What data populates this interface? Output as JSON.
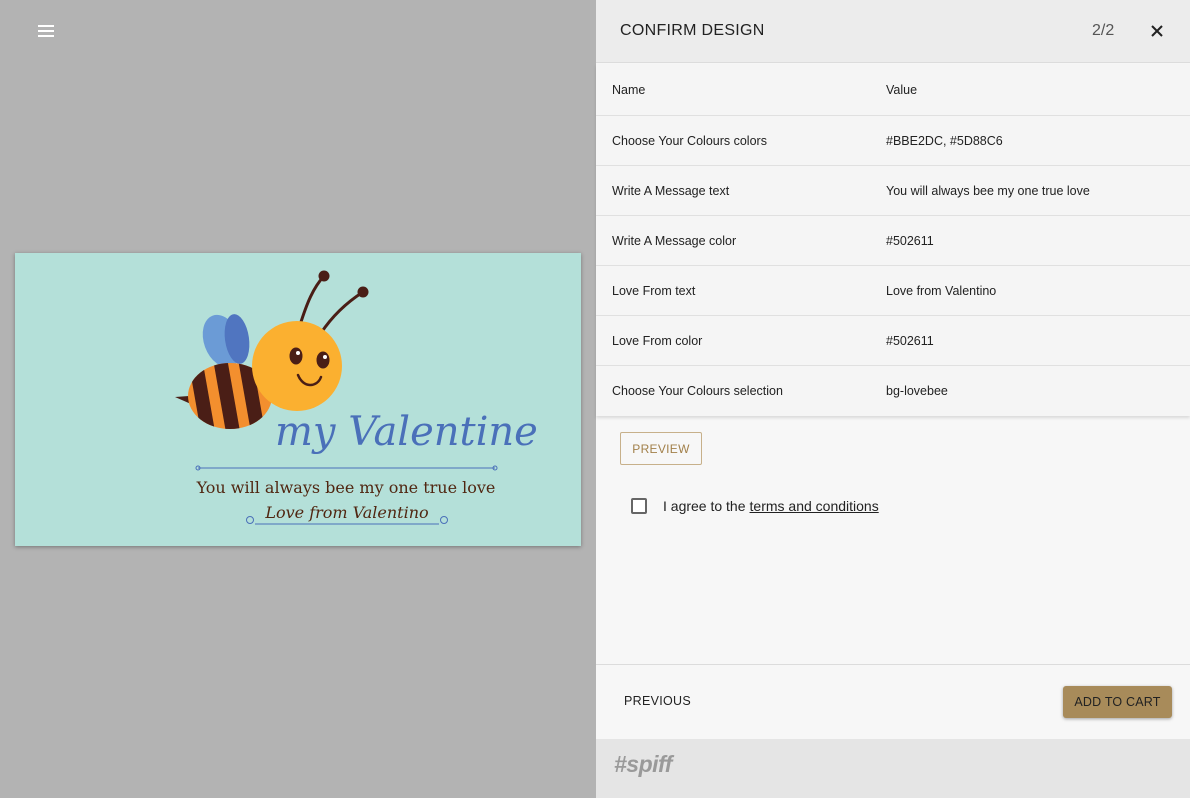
{
  "left": {
    "card": {
      "heading": "my Valentine",
      "message": "You will always bee my one true love",
      "love_from": "Love from Valentino",
      "colors": {
        "background": "#B4E0D9",
        "heading": "#4A70B9",
        "text": "#502611",
        "bee_body": "#FBB030",
        "bee_stripe": "#F38F2E",
        "bee_dark": "#4A1E16",
        "wing_light": "#6B9BD6",
        "wing_dark": "#5075C0"
      }
    }
  },
  "panel": {
    "title": "CONFIRM DESIGN",
    "step": "2/2",
    "table": {
      "header": {
        "name": "Name",
        "value": "Value"
      },
      "rows": [
        {
          "name": "Choose Your Colours colors",
          "value": "#BBE2DC, #5D88C6"
        },
        {
          "name": "Write A Message text",
          "value": "You will always bee my one true love"
        },
        {
          "name": "Write A Message color",
          "value": "#502611"
        },
        {
          "name": "Love From text",
          "value": "Love from Valentino"
        },
        {
          "name": "Love From color",
          "value": "#502611"
        },
        {
          "name": "Choose Your Colours selection",
          "value": "bg-lovebee"
        }
      ]
    },
    "preview_label": "PREVIEW",
    "agree": {
      "text": "I agree to the",
      "link": "terms and conditions",
      "checked": false
    },
    "footer": {
      "previous_label": "PREVIOUS",
      "add_to_cart_label": "ADD TO CART"
    },
    "brand": "#spiff"
  },
  "colors": {
    "backdrop": "#B3B3B3",
    "panel_bg": "#F7F7F7",
    "accent": "#A88B5A",
    "accent_text": "#A2804A"
  },
  "icons": {
    "menu": "hamburger-menu-icon",
    "close": "close-icon",
    "checkbox": "checkbox-unchecked-icon"
  }
}
